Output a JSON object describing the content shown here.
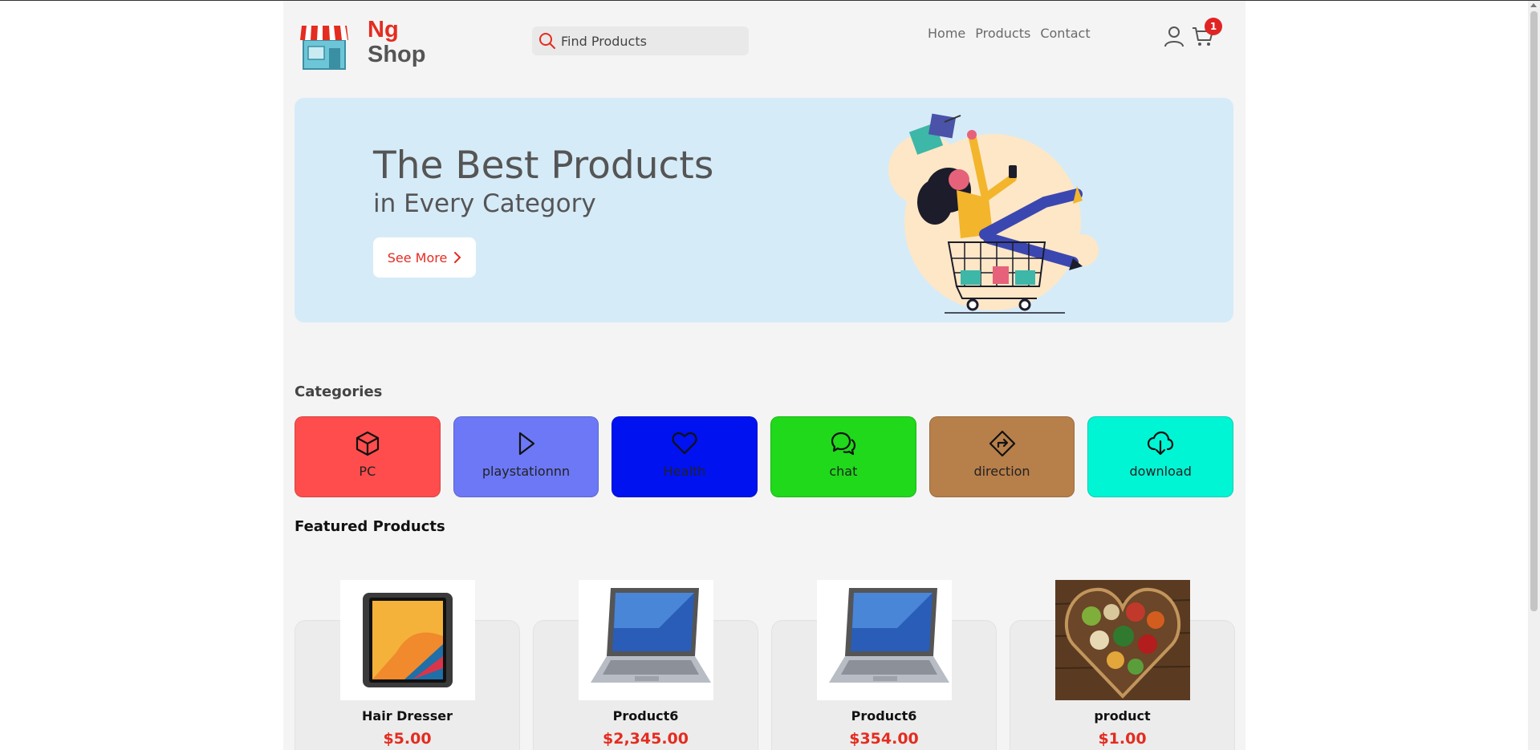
{
  "header": {
    "logo": {
      "line1": "Ng",
      "line2": "Shop"
    },
    "search": {
      "placeholder": "Find Products"
    },
    "nav": [
      "Home",
      "Products",
      "Contact"
    ],
    "cart_count": "1"
  },
  "hero": {
    "title": "The Best Products",
    "subtitle": "in Every Category",
    "button_label": "See More"
  },
  "categories": {
    "title": "Categories",
    "items": [
      {
        "name": "PC",
        "icon": "box-icon",
        "color": "#ff4d4d"
      },
      {
        "name": "playstationnn",
        "icon": "play-icon",
        "color": "#6c78f5"
      },
      {
        "name": "Health",
        "icon": "heart-icon",
        "color": "#0012f0"
      },
      {
        "name": "chat",
        "icon": "chat-icon",
        "color": "#1fd91a"
      },
      {
        "name": "direction",
        "icon": "direction-icon",
        "color": "#b77f4a"
      },
      {
        "name": "download",
        "icon": "cloud-download-icon",
        "color": "#00f5d4"
      }
    ]
  },
  "featured": {
    "title": "Featured Products",
    "products": [
      {
        "name": "Hair Dresser",
        "price": "$5.00",
        "image": "tablet-image"
      },
      {
        "name": "Product6",
        "price": "$2,345.00",
        "image": "laptop-image"
      },
      {
        "name": "Product6",
        "price": "$354.00",
        "image": "laptop-image"
      },
      {
        "name": "product",
        "price": "$1.00",
        "image": "food-bowl-image"
      }
    ]
  }
}
